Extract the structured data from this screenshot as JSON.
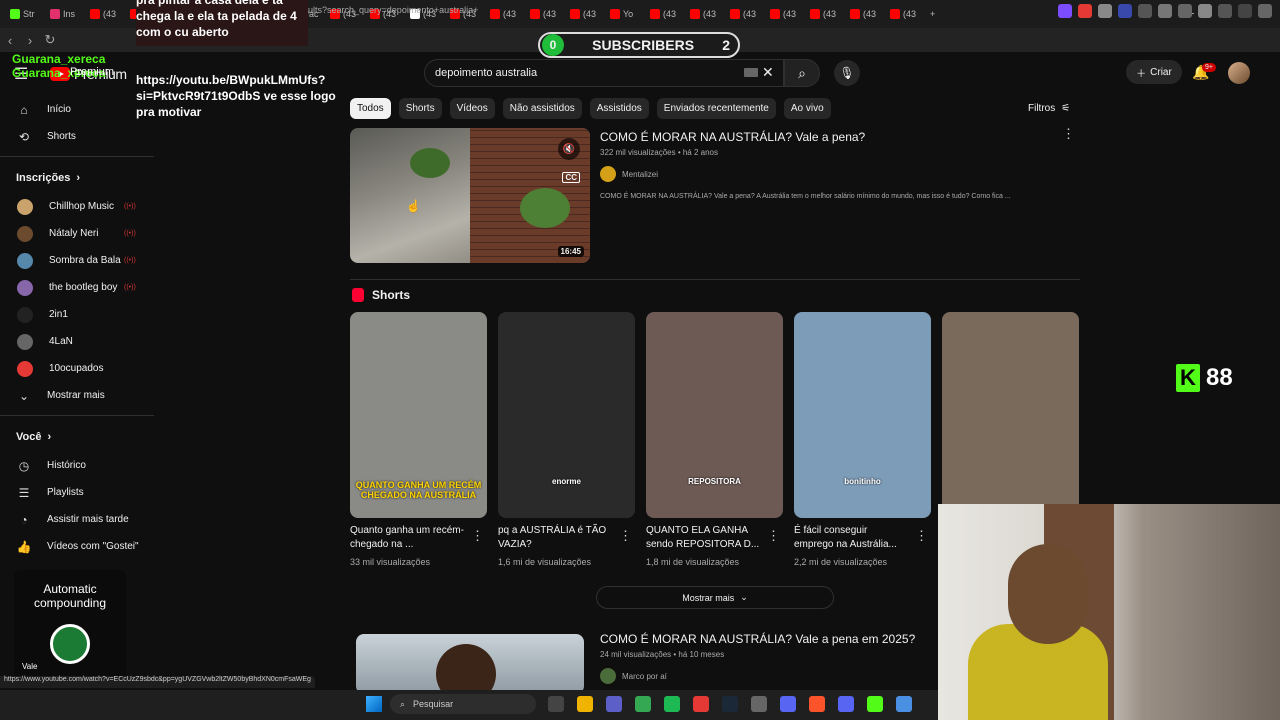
{
  "browser": {
    "tabs": [
      {
        "label": "Str",
        "color": "#53fc18"
      },
      {
        "label": "Ins",
        "color": "#e1306c"
      },
      {
        "label": "(43",
        "color": "#ff0000"
      },
      {
        "label": "(43",
        "color": "#ff0000"
      },
      {
        "label": "(43",
        "color": "#ff0000"
      },
      {
        "label": "Scr",
        "color": "#8a5cf5"
      },
      {
        "label": "20",
        "color": "#e53935"
      },
      {
        "label": "Pác",
        "color": "#ffffff"
      },
      {
        "label": "(43",
        "color": "#ff0000"
      },
      {
        "label": "(43",
        "color": "#ff0000"
      },
      {
        "label": "(43",
        "color": "#ffffff"
      },
      {
        "label": "(43",
        "color": "#ff0000"
      },
      {
        "label": "(43",
        "color": "#ff0000"
      },
      {
        "label": "(43",
        "color": "#ff0000"
      },
      {
        "label": "(43",
        "color": "#ff0000"
      },
      {
        "label": "Yo",
        "color": "#ff0000"
      },
      {
        "label": "(43",
        "color": "#ff0000"
      },
      {
        "label": "(43",
        "color": "#ff0000"
      },
      {
        "label": "(43",
        "color": "#ff0000"
      },
      {
        "label": "(43",
        "color": "#ff0000"
      },
      {
        "label": "(43",
        "color": "#ff0000"
      },
      {
        "label": "(43",
        "color": "#ff0000"
      },
      {
        "label": "(43",
        "color": "#ff0000"
      }
    ],
    "new_tab": "+",
    "url": "ults?search_query=depoimento+australia+",
    "status_url": "https://www.youtube.com/watch?v=ECcUzZ9sbdc&pp=ygUVZGVwb2ltZW50byBhdXN0cmFsaWEg"
  },
  "youtube": {
    "logo_text": "Premium",
    "search_value": "depoimento australia",
    "create_label": "Criar",
    "notif_badge": "9+",
    "sidebar": {
      "main": [
        {
          "label": "Início",
          "icon": "home-icon",
          "glyph": "⌂"
        },
        {
          "label": "Shorts",
          "icon": "shorts-icon",
          "glyph": "⟲"
        }
      ],
      "subs_head": "Inscrições",
      "subs": [
        {
          "label": "Chillhop Music",
          "color": "#c9a36b",
          "live": true
        },
        {
          "label": "Nátaly Neri",
          "color": "#6b4a2e",
          "live": true
        },
        {
          "label": "Sombra da Bala",
          "color": "#5588aa",
          "live": true
        },
        {
          "label": "the bootleg boy",
          "color": "#8866aa",
          "live": true
        },
        {
          "label": "2in1",
          "color": "#222222",
          "live": false
        },
        {
          "label": "4LaN",
          "color": "#666666",
          "live": false
        },
        {
          "label": "10ocupados",
          "color": "#e53935",
          "live": false
        }
      ],
      "more_label": "Mostrar mais",
      "you_head": "Você",
      "you": [
        {
          "label": "Histórico",
          "icon": "history-icon",
          "glyph": "◷"
        },
        {
          "label": "Playlists",
          "icon": "playlist-icon",
          "glyph": "☰"
        },
        {
          "label": "Assistir mais tarde",
          "icon": "clock-icon",
          "glyph": "◔"
        },
        {
          "label": "Vídeos com \"Gostei\"",
          "icon": "like-icon",
          "glyph": "👍"
        }
      ]
    },
    "chips": [
      "Todos",
      "Shorts",
      "Vídeos",
      "Não assistidos",
      "Assistidos",
      "Enviados recentemente",
      "Ao vivo"
    ],
    "filters_label": "Filtros",
    "video1": {
      "title": "COMO É MORAR NA AUSTRÁLIA? Vale a pena?",
      "meta": "322 mil visualizações • há 2 anos",
      "channel": "Mentalizei",
      "duration": "16:45",
      "desc": "COMO É MORAR NA AUSTRÁLIA? Vale a pena? A Austrália tem o melhor salário mínimo do mundo, mas isso é tudo? Como fica ..."
    },
    "shorts_head": "Shorts",
    "shorts": [
      {
        "title": "Quanto ganha um recém-chegado na ...",
        "views": "33 mil visualizações",
        "caption": "QUANTO GANHA UM RECÉM CHEGADO NA AUSTRÁLIA",
        "bg": "#8a8a86"
      },
      {
        "title": "pq a AUSTRÁLIA é TÃO VAZIA?",
        "views": "1,6 mi de visualizações",
        "caption": "enorme",
        "bg": "#2a2a2a"
      },
      {
        "title": "QUANTO ELA GANHA sendo REPOSITORA D...",
        "views": "1,8 mi de visualizações",
        "caption": "REPOSITORA",
        "bg": "#6d5a55"
      },
      {
        "title": "É fácil conseguir emprego na Austrália...",
        "views": "2,2 mi de visualizações",
        "caption": "bonitinho",
        "bg": "#7d9cb8"
      },
      {
        "title": "",
        "views": "",
        "caption": "",
        "bg": "#7a6a5c"
      }
    ],
    "more_shorts": "Mostrar mais",
    "video2": {
      "title": "COMO É MORAR NA AUSTRÁLIA? Vale a pena em 2025?",
      "meta": "24 mil visualizações • há 10 meses",
      "channel": "Marco por aí"
    }
  },
  "overlays": {
    "chat_text": "pra pintar a casa dela e ta chega la e ela ta pelada de 4 com o cu aberto",
    "guarana": "Guarana_xereca",
    "link_text": "https://youtu.be/BWpukLMmUfs?si=PktvcR9t71t9OdbS ve esse logo pra motivar",
    "sub_count_left": "0",
    "sub_label": "SUBSCRIBERS",
    "sub_count_right": "2",
    "kick_viewers": "88",
    "autocomp_title": "Automatic compounding",
    "autocomp_tag": "Vale"
  },
  "taskbar": {
    "search_placeholder": "Pesquisar"
  }
}
